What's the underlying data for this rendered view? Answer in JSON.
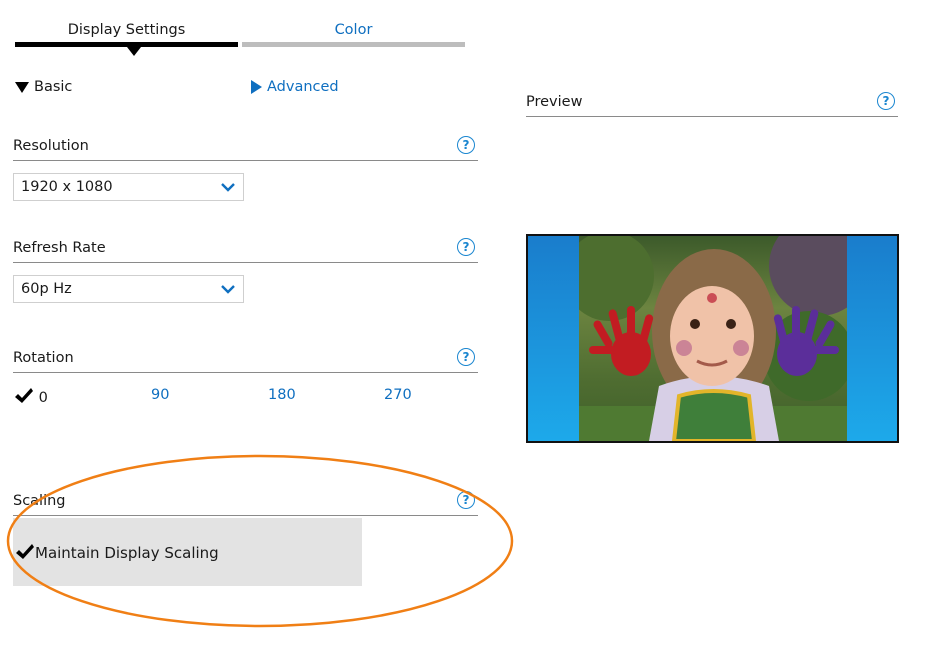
{
  "tabs": [
    {
      "label": "Display Settings",
      "active": true
    },
    {
      "label": "Color",
      "active": false
    }
  ],
  "modes": {
    "basic": {
      "label": "Basic",
      "expanded": true
    },
    "advanced": {
      "label": "Advanced",
      "expanded": false
    }
  },
  "resolution": {
    "title": "Resolution",
    "selected": "1920 x 1080",
    "help": "?"
  },
  "refresh_rate": {
    "title": "Refresh Rate",
    "selected": "60p Hz",
    "help": "?"
  },
  "rotation": {
    "title": "Rotation",
    "help": "?",
    "options": [
      "0",
      "90",
      "180",
      "270"
    ],
    "selected": "0"
  },
  "scaling": {
    "title": "Scaling",
    "help": "?",
    "option_label": "Maintain Display Scaling",
    "checked": true
  },
  "preview": {
    "title": "Preview",
    "help": "?",
    "image_description": "child with painted hands"
  },
  "colors": {
    "accent": "#0f6fc0",
    "help_icon": "#1a86d0",
    "annotation": "#f07f15",
    "selection_bg": "#e3e3e3"
  }
}
